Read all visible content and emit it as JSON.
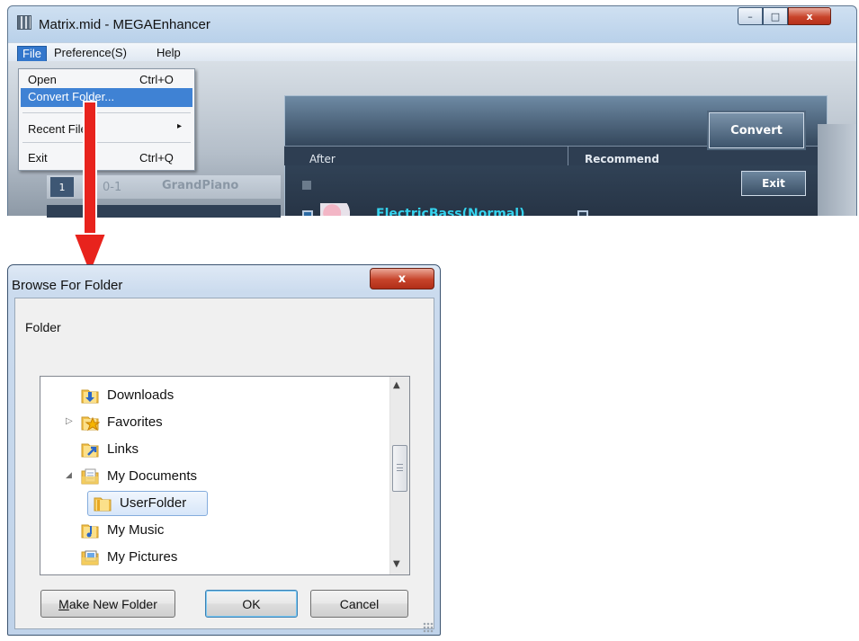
{
  "app": {
    "title": "Matrix.mid - MEGAEnhancer",
    "caption": {
      "minimize": "–",
      "maximize": "□",
      "close": "x"
    },
    "menubar": [
      "File",
      "Preference(S)",
      "Help"
    ],
    "file_menu": {
      "items": [
        {
          "label": "Open",
          "accel": "Ctrl+O"
        },
        {
          "label": "Convert Folder...",
          "accel": ""
        },
        {
          "label": "Recent Files",
          "accel": "",
          "submenu_arrow": "▸"
        },
        {
          "label": "Exit",
          "accel": "Ctrl+Q"
        }
      ]
    },
    "table": {
      "headers": {
        "after": "After",
        "recommend": "Recommend"
      },
      "track_number": "1",
      "track_program": "0-1",
      "track_instrument": "GrandPiano",
      "after_instrument": "ElectricBass(Normal)"
    },
    "buttons": {
      "convert": "Convert",
      "exit": "Exit"
    }
  },
  "dialog": {
    "title": "Browse For Folder",
    "close_label": "x",
    "folder_label": "Folder",
    "tree": [
      {
        "label": "Downloads",
        "expander": "",
        "icon": "downloads-folder-icon",
        "indent": 0
      },
      {
        "label": "Favorites",
        "expander": "▷",
        "icon": "favorites-folder-icon",
        "indent": 0
      },
      {
        "label": "Links",
        "expander": "",
        "icon": "links-folder-icon",
        "indent": 0
      },
      {
        "label": "My Documents",
        "expander": "◢",
        "icon": "documents-folder-icon",
        "indent": 0
      },
      {
        "label": "UserFolder",
        "expander": "",
        "icon": "folder-icon",
        "indent": 1,
        "selected": true
      },
      {
        "label": "My Music",
        "expander": "",
        "icon": "music-folder-icon",
        "indent": 0
      },
      {
        "label": "My Pictures",
        "expander": "",
        "icon": "pictures-folder-icon",
        "indent": 0
      }
    ],
    "buttons": {
      "make_new_folder_mnemonic": "M",
      "make_new_folder_rest": "ake New Folder",
      "ok": "OK",
      "cancel": "Cancel"
    }
  },
  "colors": {
    "arrow": "#e8231d",
    "selection": "#3f82d4",
    "instrument_text": "#35d3ee"
  }
}
